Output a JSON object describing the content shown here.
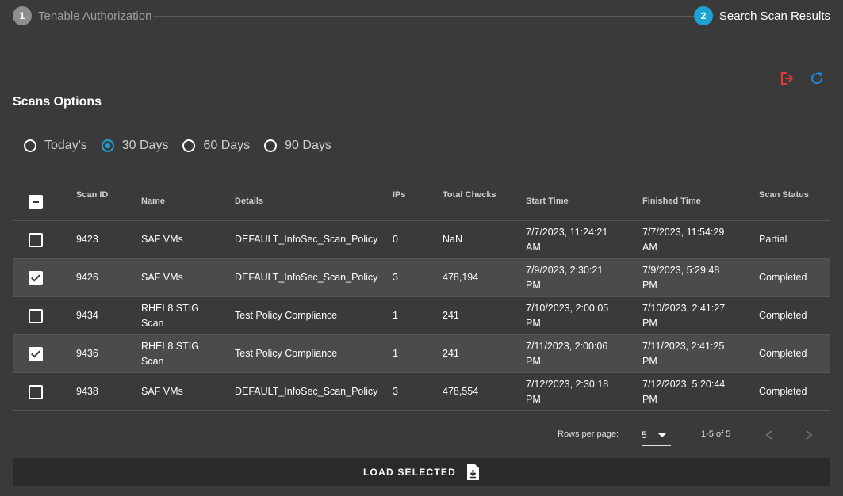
{
  "stepper": {
    "steps": [
      {
        "number": "1",
        "label": "Tenable Authorization"
      },
      {
        "number": "2",
        "label": "Search Scan Results"
      }
    ]
  },
  "icons": {
    "logout": "logout-icon",
    "refresh": "refresh-icon",
    "logout_color": "#e53935",
    "refresh_color": "#1e88e5"
  },
  "section_title": "Scans Options",
  "radio_options": [
    {
      "label": "Today's",
      "checked": false
    },
    {
      "label": "30 Days",
      "checked": true
    },
    {
      "label": "60 Days",
      "checked": false
    },
    {
      "label": "90 Days",
      "checked": false
    }
  ],
  "table": {
    "headers": {
      "scan_id": "Scan ID",
      "name": "Name",
      "details": "Details",
      "ips": "IPs",
      "total_checks": "Total Checks",
      "start_time": "Start Time",
      "finished_time": "Finished Time",
      "scan_status": "Scan Status"
    },
    "rows": [
      {
        "checked": false,
        "scan_id": "9423",
        "name": "SAF VMs",
        "details": "DEFAULT_InfoSec_Scan_Policy",
        "ips": "0",
        "total_checks": "NaN",
        "start_line1": "7/7/2023, 11:24:21",
        "start_line2": "AM",
        "finish_line1": "7/7/2023, 11:54:29",
        "finish_line2": "AM",
        "status": "Partial"
      },
      {
        "checked": true,
        "scan_id": "9426",
        "name": "SAF VMs",
        "details": "DEFAULT_InfoSec_Scan_Policy",
        "ips": "3",
        "total_checks": "478,194",
        "start_line1": "7/9/2023, 2:30:21",
        "start_line2": "PM",
        "finish_line1": "7/9/2023, 5:29:48",
        "finish_line2": "PM",
        "status": "Completed"
      },
      {
        "checked": false,
        "scan_id": "9434",
        "name_line1": "RHEL8 STIG",
        "name_line2": "Scan",
        "details": "Test Policy Compliance",
        "ips": "1",
        "total_checks": "241",
        "start_line1": "7/10/2023, 2:00:05",
        "start_line2": "PM",
        "finish_line1": "7/10/2023, 2:41:27",
        "finish_line2": "PM",
        "status": "Completed"
      },
      {
        "checked": true,
        "scan_id": "9436",
        "name_line1": "RHEL8 STIG",
        "name_line2": "Scan",
        "details": "Test Policy Compliance",
        "ips": "1",
        "total_checks": "241",
        "start_line1": "7/11/2023, 2:00:06",
        "start_line2": "PM",
        "finish_line1": "7/11/2023, 2:41:25",
        "finish_line2": "PM",
        "status": "Completed"
      },
      {
        "checked": false,
        "scan_id": "9438",
        "name": "SAF VMs",
        "details": "DEFAULT_InfoSec_Scan_Policy",
        "ips": "3",
        "total_checks": "478,554",
        "start_line1": "7/12/2023, 2:30:18",
        "start_line2": "PM",
        "finish_line1": "7/12/2023, 5:20:44",
        "finish_line2": "PM",
        "status": "Completed"
      }
    ]
  },
  "pagination": {
    "rows_per_page_label": "Rows per page:",
    "rows_per_page_value": "5",
    "range": "1-5 of 5"
  },
  "load_button": {
    "label": "LOAD SELECTED"
  },
  "colors": {
    "accent": "#1ba3d4",
    "background": "#3a3a3a",
    "selected_row": "#4b4b4b",
    "button_bg": "#2a2a2a"
  }
}
